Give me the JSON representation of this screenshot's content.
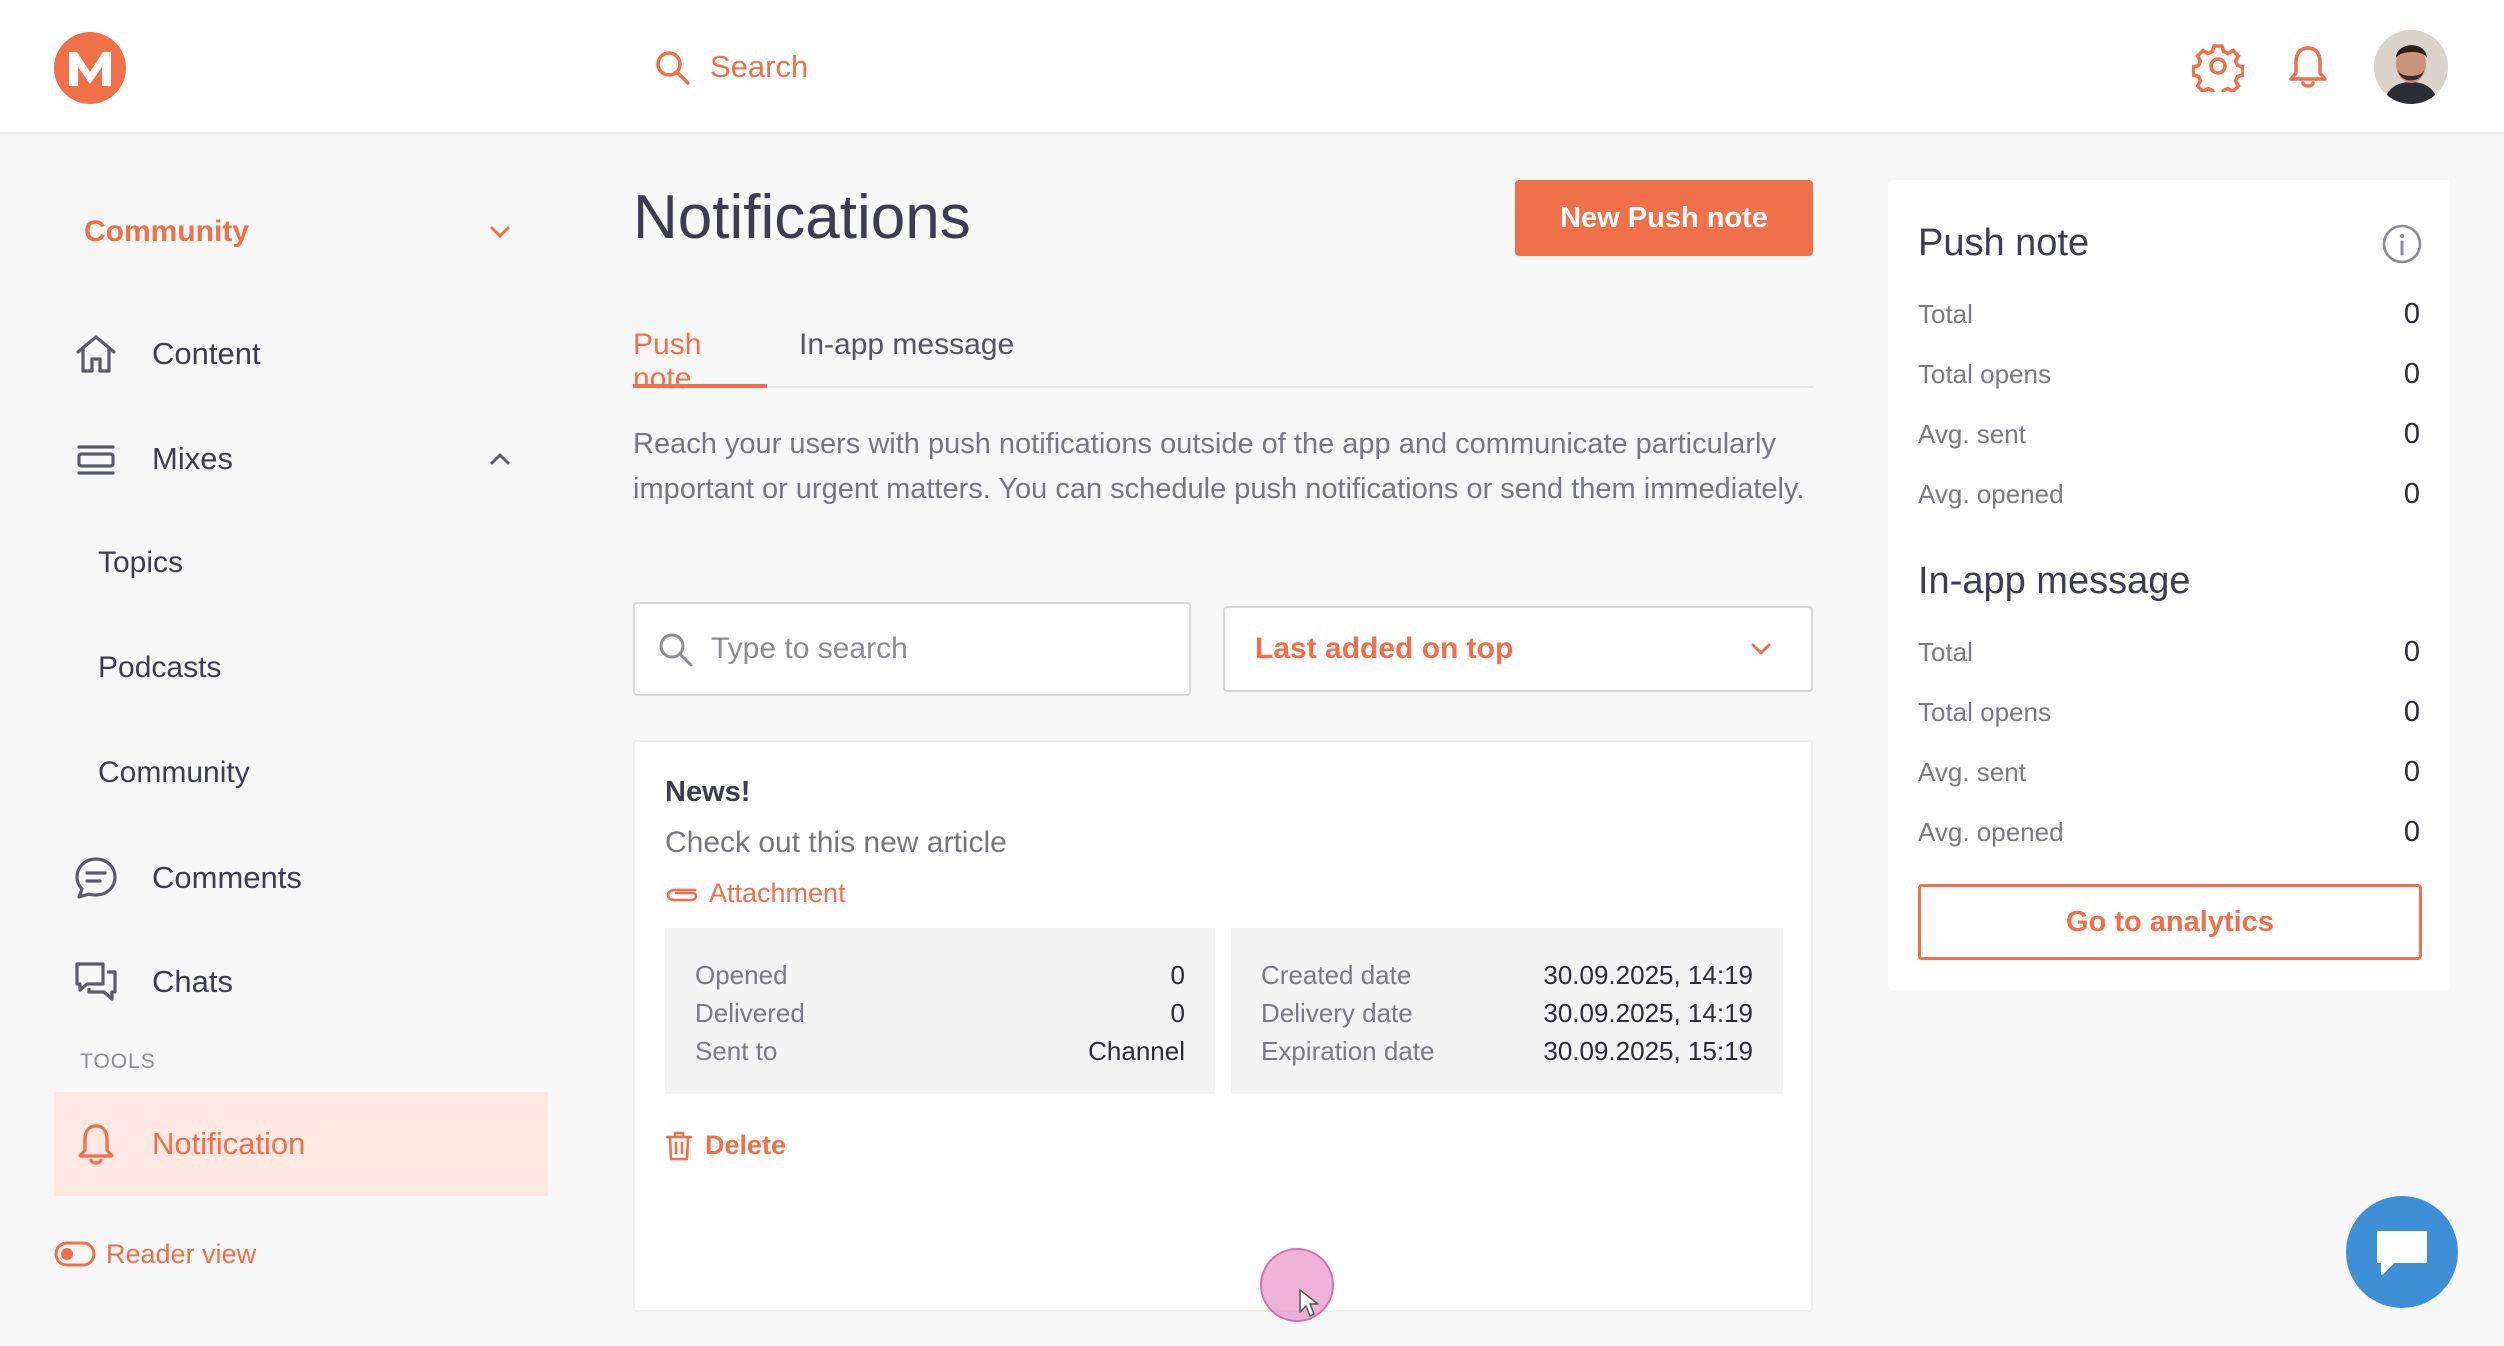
{
  "header": {
    "search_label": "Search"
  },
  "sidebar": {
    "community_select": "Community",
    "items": [
      {
        "label": "Content",
        "icon": "home-icon"
      },
      {
        "label": "Mixes",
        "icon": "layers-icon"
      },
      {
        "label": "Comments",
        "icon": "comment-icon"
      },
      {
        "label": "Chats",
        "icon": "chats-icon"
      }
    ],
    "mixes_children": [
      "Topics",
      "Podcasts",
      "Community"
    ],
    "tools_label": "TOOLS",
    "active_item": {
      "label": "Notification",
      "icon": "bell-icon"
    },
    "reader_view": "Reader view"
  },
  "main": {
    "title": "Notifications",
    "new_button": "New Push note",
    "tabs": [
      {
        "label": "Push note",
        "active": true
      },
      {
        "label": "In-app message",
        "active": false
      }
    ],
    "description": "Reach your users with push notifications outside of the app and communicate particularly important or urgent matters. You can schedule push notifications or send them immediately.",
    "search_placeholder": "Type to search",
    "sort_value": "Last added on top",
    "card": {
      "title": "News!",
      "body": "Check out this new article",
      "attachment": "Attachment",
      "stats_left": [
        {
          "key": "Opened",
          "value": "0"
        },
        {
          "key": "Delivered",
          "value": "0"
        },
        {
          "key": "Sent to",
          "value": "Channel"
        }
      ],
      "stats_right": [
        {
          "key": "Created date",
          "value": "30.09.2025, 14:19"
        },
        {
          "key": "Delivery date",
          "value": "30.09.2025, 14:19"
        },
        {
          "key": "Expiration date",
          "value": "30.09.2025, 15:19"
        }
      ],
      "delete": "Delete"
    }
  },
  "panel": {
    "push": {
      "title": "Push note",
      "rows": [
        {
          "key": "Total",
          "value": "0"
        },
        {
          "key": "Total opens",
          "value": "0"
        },
        {
          "key": "Avg. sent",
          "value": "0"
        },
        {
          "key": "Avg. opened",
          "value": "0"
        }
      ]
    },
    "inapp": {
      "title": "In-app message",
      "rows": [
        {
          "key": "Total",
          "value": "0"
        },
        {
          "key": "Total opens",
          "value": "0"
        },
        {
          "key": "Avg. sent",
          "value": "0"
        },
        {
          "key": "Avg. opened",
          "value": "0"
        }
      ]
    },
    "analytics_button": "Go to analytics"
  },
  "colors": {
    "accent": "#ef7049",
    "active_bg": "#fde8e2",
    "chat_fab": "#3e8fd6"
  }
}
